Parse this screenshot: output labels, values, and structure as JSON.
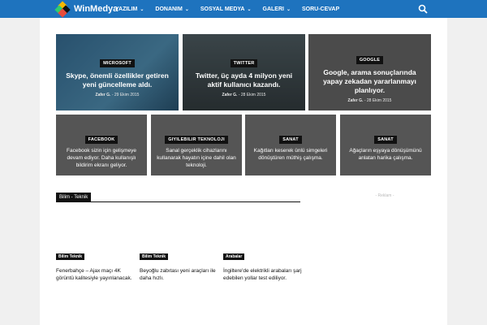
{
  "header": {
    "logo_text": "WinMedya",
    "nav": [
      {
        "label": "YAZILIM",
        "has_dropdown": true
      },
      {
        "label": "DONANIM",
        "has_dropdown": true
      },
      {
        "label": "SOSYAL MEDYA",
        "has_dropdown": true
      },
      {
        "label": "GALERI",
        "has_dropdown": true
      },
      {
        "label": "SORU-CEVAP",
        "has_dropdown": false
      }
    ],
    "search_icon": "search-icon",
    "colors": {
      "bar": "#1e73be"
    }
  },
  "featured": [
    {
      "category": "MICROSOFT",
      "title": "Skype, önemli özellikler getiren yeni güncelleme aldı.",
      "author": "Zafer G.",
      "date": "29 Ekim 2015"
    },
    {
      "category": "TWITTER",
      "title": "Twitter, üç ayda 4 milyon yeni aktif kullanıcı kazandı.",
      "author": "Zafer G.",
      "date": "28 Ekim 2015"
    },
    {
      "category": "GOOGLE",
      "title": "Google, arama sonuçlarında yapay zekadan yararlanmayı planlıyor.",
      "author": "Zafer G.",
      "date": "28 Ekim 2015"
    }
  ],
  "secondary": [
    {
      "category": "FACEBOOK",
      "title": "Facebook sizin için gelişmeye devam ediyor. Daha kullanışlı bildirim ekranı geliyor."
    },
    {
      "category": "GIYILEBILIR TEKNOLOJI",
      "title": "Sanal gerçeklik cihazlarını kullanarak hayatın içine dahil olan teknoloji."
    },
    {
      "category": "SANAT",
      "title": "Kağıtları keserek ünlü simgeleri dönüştüren müthiş çalışma."
    },
    {
      "category": "SANAT",
      "title": "Ağaçların eşyaya dönüşümünü anlatan harika çalışma."
    }
  ],
  "section": {
    "title": "Bilim - Teknik",
    "ad_label": "- Reklam -",
    "articles": [
      {
        "category": "Bilim Teknik",
        "title": "Fenerbahçe – Ajax maçı 4K görüntü kalitesiyle yayınlanacak."
      },
      {
        "category": "Bilim Teknik",
        "title": "Beyoğlu zabıtası yeni araçları ile daha hızlı."
      },
      {
        "category": "Arabalar",
        "title": "İngiltere'de elektrikli arabaları şarj edebilen yollar test ediliyor."
      }
    ]
  }
}
